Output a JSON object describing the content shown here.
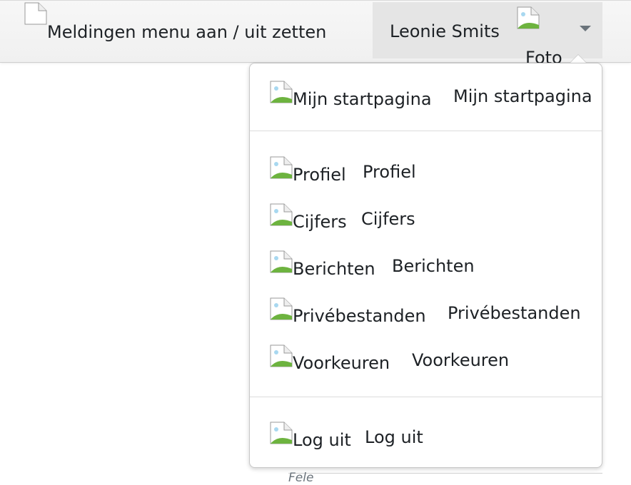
{
  "navbar": {
    "notifications_toggle": "Meldingen menu aan / uit zetten",
    "user_name": "Leonie Smits",
    "avatar_alt": "Foto"
  },
  "user_menu": {
    "items": [
      {
        "alt": "Mijn startpagina",
        "label": "Mijn startpagina",
        "icon": "broken-image-icon"
      },
      {
        "alt": "Profiel",
        "label": "Profiel",
        "icon": "broken-image-icon"
      },
      {
        "alt": "Cijfers",
        "label": "Cijfers",
        "icon": "broken-image-icon"
      },
      {
        "alt": "Berichten",
        "label": "Berichten",
        "icon": "broken-image-icon"
      },
      {
        "alt": "Privébestanden",
        "label": "Privébestanden",
        "icon": "broken-image-icon"
      },
      {
        "alt": "Voorkeuren",
        "label": "Voorkeuren",
        "icon": "broken-image-icon"
      },
      {
        "alt": "Log uit",
        "label": "Log uit",
        "icon": "broken-image-icon"
      }
    ]
  },
  "background": {
    "partial_text": "Fele"
  }
}
